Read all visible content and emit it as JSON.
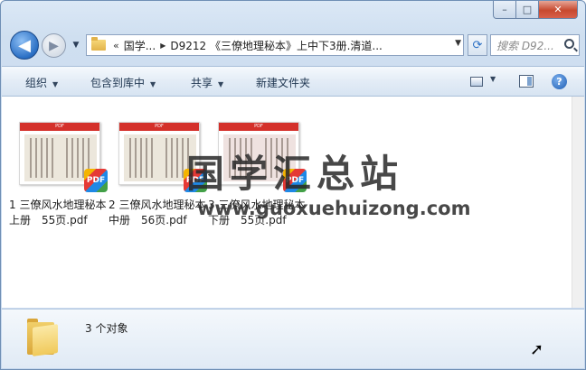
{
  "window": {
    "minimize_label": "–",
    "maximize_label": "□",
    "close_label": "✕"
  },
  "nav": {
    "back_label": "◀",
    "forward_label": "▶",
    "recent_label": "▼",
    "address": {
      "overflow": "«",
      "crumb_1": "国学...",
      "sep": "▶",
      "path": "D9212 《三僚地理秘本》上中下3册.清道..."
    },
    "refresh_label": "⟳",
    "search_placeholder": "搜索 D92..."
  },
  "toolbar": {
    "organize": "组织",
    "include_in_library": "包含到库中",
    "share": "共享",
    "new_folder": "新建文件夹",
    "dropdown_arrow": "▼",
    "help_label": "?"
  },
  "files": [
    {
      "name": "1 三僚风水地理秘本上册　55页.pdf",
      "thumb_label": "PDF",
      "badge": "PDF"
    },
    {
      "name": "2 三僚风水地理秘本中册　56页.pdf",
      "thumb_label": "PDF",
      "badge": "PDF"
    },
    {
      "name": "3 三僚风水地理秘本下册　55页.pdf",
      "thumb_label": "PDF",
      "badge": "PDF"
    }
  ],
  "watermark": {
    "cn": "国学汇总站",
    "en": "www.guoxuehuizong.com"
  },
  "details": {
    "item_count": "3 个对象"
  }
}
